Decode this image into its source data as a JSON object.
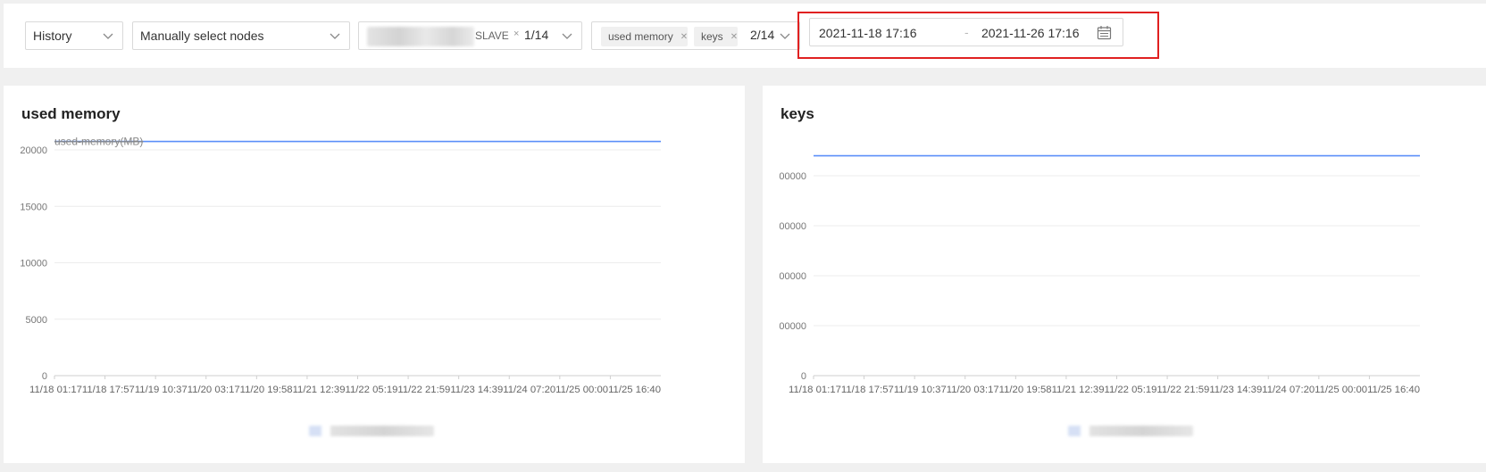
{
  "filters": {
    "mode": "History",
    "selection": "Manually select nodes",
    "nodes": {
      "tag_suffix": "SLAVE",
      "count": "1/14"
    },
    "metrics": {
      "tags": [
        "used memory",
        "keys"
      ],
      "count": "2/14"
    },
    "date_range": {
      "start": "2021-11-18 17:16",
      "separator": "-",
      "end": "2021-11-26 17:16"
    }
  },
  "icons": {
    "dropdown": "chevron-down-icon",
    "tag_remove": "close-icon",
    "date_picker": "calendar-icon"
  },
  "colors": {
    "series_line": "#5b8ff9",
    "highlight_border": "#e02020"
  },
  "chart_data": [
    {
      "type": "line",
      "title": "used memory",
      "x": [
        "11/18 01:17",
        "11/18 17:57",
        "11/19 10:37",
        "11/20 03:17",
        "11/20 19:58",
        "11/21 12:39",
        "11/22 05:19",
        "11/22 21:59",
        "11/23 14:39",
        "11/24 07:20",
        "11/25 00:00",
        "11/25 16:40"
      ],
      "x_tick_labels": [
        "11/18 01:17",
        "11/18 17:57",
        "11/19 10:37",
        "11/20 03:17",
        "11/20 19:58",
        "11/21 12:39",
        "11/22 05:19",
        "11/22 21:59",
        "11/23 14:39",
        "11/24 07:20",
        "11/25 00:00",
        "11/25 16:40"
      ],
      "y_ticks": [
        "0",
        "5000",
        "10000",
        "15000",
        "20000"
      ],
      "ylim": [
        0,
        20000
      ],
      "series": [
        {
          "name": "used-memory(MB)",
          "values": [
            20750,
            20750,
            20750,
            20750,
            20750,
            20750,
            20750,
            20750,
            20750,
            20750,
            20750,
            20750
          ]
        }
      ],
      "grid": true
    },
    {
      "type": "line",
      "title": "keys",
      "x": [
        "11/18 01:17",
        "11/18 17:57",
        "11/19 10:37",
        "11/20 03:17",
        "11/20 19:58",
        "11/21 12:39",
        "11/22 05:19",
        "11/22 21:59",
        "11/23 14:39",
        "11/24 07:20",
        "11/25 00:00",
        "11/25 16:40"
      ],
      "x_tick_labels": [
        "11/18 01:17",
        "11/18 17:57",
        "11/19 10:37",
        "11/20 03:17",
        "11/20 19:58",
        "11/21 12:39",
        "11/22 05:19",
        "11/22 21:59",
        "11/23 14:39",
        "11/24 07:20",
        "11/25 00:00",
        "11/25 16:40"
      ],
      "y_ticks": [
        "0",
        "00000",
        "00000",
        "00000",
        "00000"
      ],
      "series": [
        {
          "values": [
            5.5,
            5.5,
            5.5,
            5.5,
            5.5,
            5.5,
            5.5,
            5.5,
            5.5,
            5.5,
            5.5,
            5.5
          ]
        }
      ],
      "ylim": [
        0,
        5
      ],
      "grid": true
    }
  ]
}
